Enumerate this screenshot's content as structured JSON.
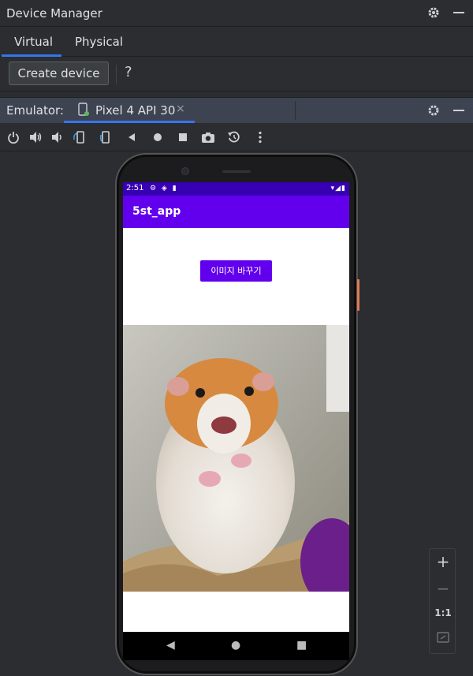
{
  "device_manager": {
    "title": "Device Manager",
    "tabs": [
      {
        "label": "Virtual",
        "active": true
      },
      {
        "label": "Physical",
        "active": false
      }
    ],
    "create_button": "Create device",
    "help_label": "?"
  },
  "emulator": {
    "label": "Emulator:",
    "tab_name": "Pixel 4 API 30",
    "close_glyph": "×",
    "toolbar_icons": [
      "power-icon",
      "volume-up-icon",
      "volume-down-icon",
      "rotate-left-icon",
      "rotate-right-icon",
      "back-icon",
      "home-icon",
      "overview-icon",
      "screenshot-icon",
      "snapshot-icon",
      "more-icon"
    ]
  },
  "phone": {
    "status_time": "2:51",
    "app_title": "5st_app",
    "button_label": "이미지 바꾸기",
    "photo_description": "hamster-photo"
  },
  "zoom_controls": {
    "in": "+",
    "out": "−",
    "one_to_one": "1:1"
  },
  "colors": {
    "accent": "#3574f0",
    "app_primary": "#6200ee",
    "status_bar": "#3700b3"
  }
}
